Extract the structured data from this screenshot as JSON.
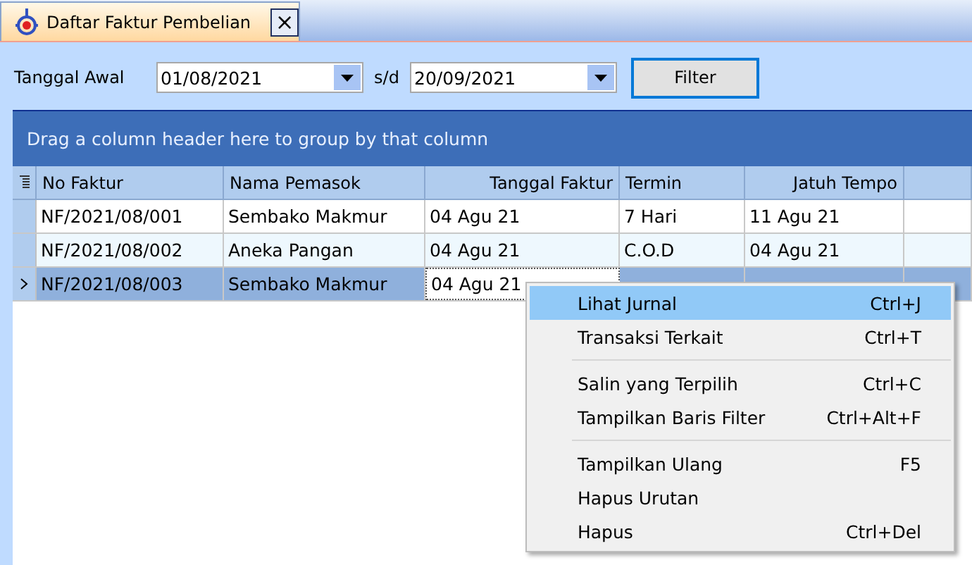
{
  "tab": {
    "title": "Daftar Faktur Pembelian",
    "close": "×",
    "selected": true
  },
  "filter": {
    "start_label": "Tanggal Awal",
    "start_value": "01/08/2021",
    "separator": "s/d",
    "end_value": "20/09/2021",
    "button": "Filter"
  },
  "group_panel": {
    "hint": "Drag a column header here to group by that column"
  },
  "table": {
    "columns": [
      "No Faktur",
      "Nama Pemasok",
      "Tanggal Faktur",
      "Termin",
      "Jatuh Tempo"
    ],
    "rows": [
      {
        "selected": false,
        "cells": [
          {
            "text": "NF/2021/08/001",
            "focused": false
          },
          {
            "text": "Sembako Makmur",
            "focused": false
          },
          {
            "text": "04 Agu 21",
            "focused": false
          },
          {
            "text": "7 Hari",
            "focused": false
          },
          {
            "text": "11 Agu 21",
            "focused": false
          }
        ]
      },
      {
        "selected": false,
        "cells": [
          {
            "text": "NF/2021/08/002",
            "focused": false
          },
          {
            "text": "Aneka Pangan",
            "focused": false
          },
          {
            "text": "04 Agu 21",
            "focused": false
          },
          {
            "text": "C.O.D",
            "focused": false
          },
          {
            "text": "04 Agu 21",
            "focused": false
          }
        ]
      },
      {
        "selected": true,
        "cells": [
          {
            "text": "NF/2021/08/003",
            "focused": false
          },
          {
            "text": "Sembako Makmur",
            "focused": false
          },
          {
            "text": "04 Agu 21",
            "focused": true
          },
          {
            "focused": false
          },
          {
            "focused": false
          }
        ]
      }
    ]
  },
  "context_menu": {
    "items": [
      {
        "kind": "item",
        "label": "Lihat Jurnal",
        "shortcut": "Ctrl+J",
        "selected": true
      },
      {
        "kind": "item",
        "label": "Transaksi Terkait",
        "shortcut": "Ctrl+T",
        "selected": false
      },
      {
        "kind": "separator"
      },
      {
        "kind": "item",
        "label": "Salin yang Terpilih",
        "shortcut": "Ctrl+C",
        "selected": false
      },
      {
        "kind": "item",
        "label": "Tampilkan Baris Filter",
        "shortcut": "Ctrl+Alt+F",
        "selected": false
      },
      {
        "kind": "separator"
      },
      {
        "kind": "item",
        "label": "Tampilkan Ulang",
        "shortcut": "F5",
        "selected": false
      },
      {
        "kind": "item",
        "label": "Hapus Urutan",
        "selected": false
      },
      {
        "kind": "item",
        "label": "Hapus",
        "shortcut": "Ctrl+Del",
        "selected": false
      }
    ]
  }
}
